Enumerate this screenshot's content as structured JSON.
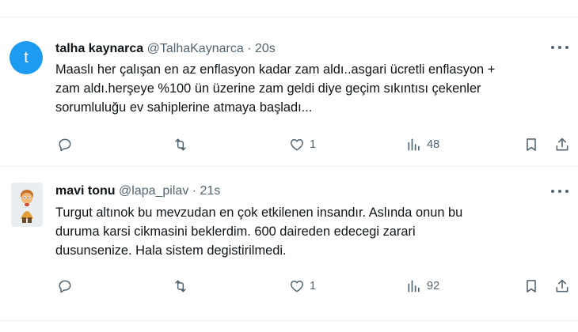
{
  "tweets": [
    {
      "avatar_letter": "t",
      "name": "talha kaynarca",
      "handle": "@TalhaKaynarca",
      "separator": "·",
      "time": "20s",
      "text_lines": [
        "Maaslı her çalışan en az enflasyon kadar zam aldı..asgari ücretli enflasyon +",
        "zam aldı.herşeye %100 ün üzerine zam geldi diye geçim sıkıntısı çekenler",
        "sorumluluğu ev sahiplerine atmaya başladı..."
      ],
      "actions": {
        "reply_icon": "reply-icon",
        "retweet_icon": "retweet-icon",
        "like_count": "1",
        "views_count": "48",
        "bookmark_icon": "bookmark-icon",
        "share_icon": "share-icon"
      }
    },
    {
      "avatar_letter": "",
      "name": "mavi tonu",
      "handle": "@lapa_pilav",
      "separator": "·",
      "time": "21s",
      "text_lines": [
        "Turgut altınok bu mevzudan en çok etkilenen insandır. Aslında onun bu",
        "duruma karsi cikmasini beklerdim. 600 daireden edecegi zarari",
        "dusunsenize. Hala sistem degistirilmedi."
      ],
      "actions": {
        "reply_icon": "reply-icon",
        "retweet_icon": "retweet-icon",
        "like_count": "1",
        "views_count": "92",
        "bookmark_icon": "bookmark-icon",
        "share_icon": "share-icon"
      }
    }
  ],
  "colors": {
    "accent": "#1d9bf0",
    "muted": "#536471",
    "text": "#0f1419",
    "divider": "#eff3f4"
  }
}
